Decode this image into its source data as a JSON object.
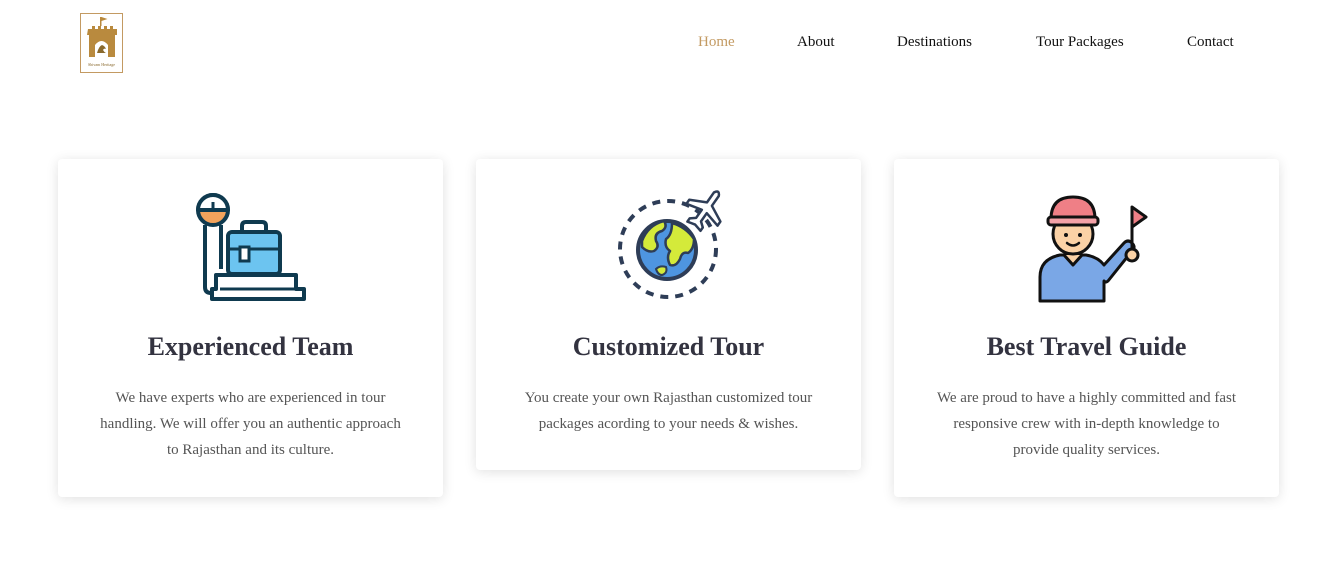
{
  "header": {
    "logo_text": "Shivam Heritage",
    "nav": [
      {
        "label": "Home",
        "active": true
      },
      {
        "label": "About",
        "active": false
      },
      {
        "label": "Destinations",
        "active": false
      },
      {
        "label": "Tour Packages",
        "active": false
      },
      {
        "label": "Contact",
        "active": false
      }
    ]
  },
  "features": [
    {
      "icon": "luggage-scale-icon",
      "title": "Experienced Team",
      "description": "We have experts who are experienced in tour handling. We will offer you an authentic approach to Rajasthan and its culture."
    },
    {
      "icon": "globe-airplane-icon",
      "title": "Customized Tour",
      "description": "You create your own Rajasthan customized tour packages acording to your needs & wishes."
    },
    {
      "icon": "tour-guide-flag-icon",
      "title": "Best Travel Guide",
      "description": "We are proud to have a highly committed and fast responsive crew with in-depth knowledge to provide quality services."
    }
  ],
  "colors": {
    "accent": "#c39a62",
    "title": "#333340",
    "body_text": "#555555"
  }
}
